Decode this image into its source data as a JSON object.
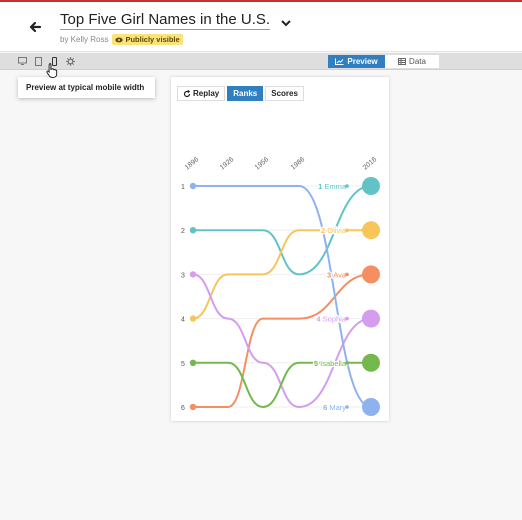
{
  "header": {
    "title": "Top Five Girl Names in the U.S.",
    "byline": "by Kelly Ross",
    "badge": "Publicly visible"
  },
  "toolbar": {
    "preview_label": "Preview",
    "data_label": "Data",
    "icons": [
      "desktop-icon",
      "tablet-icon",
      "mobile-icon",
      "settings-icon"
    ]
  },
  "tooltip": {
    "text": "Preview at typical mobile width"
  },
  "controls": {
    "replay": "Replay",
    "ranks": "Ranks",
    "scores": "Scores"
  },
  "chart_data": {
    "type": "line",
    "x": [
      "1896",
      "1926",
      "1956",
      "1986",
      "2016"
    ],
    "y_ticks": [
      "1",
      "2",
      "3",
      "4",
      "5",
      "6"
    ],
    "series": [
      {
        "name": "Emma",
        "rank_label": "1",
        "color": "#62c3c7",
        "values": [
          2,
          2,
          2,
          3,
          1
        ]
      },
      {
        "name": "Olivia",
        "rank_label": "2",
        "color": "#f7c55a",
        "values": [
          4,
          3,
          3,
          2,
          2
        ]
      },
      {
        "name": "Ava",
        "rank_label": "3",
        "color": "#f58e63",
        "values": [
          6,
          6,
          4,
          4,
          3
        ]
      },
      {
        "name": "Sophia",
        "rank_label": "4",
        "color": "#d59ded",
        "values": [
          3,
          4,
          5,
          6,
          4
        ]
      },
      {
        "name": "Isabella",
        "rank_label": "5",
        "color": "#74b84e",
        "values": [
          5,
          5,
          6,
          5,
          5
        ]
      },
      {
        "name": "Mary",
        "rank_label": "6",
        "color": "#8eb2ef",
        "values": [
          1,
          1,
          1,
          1,
          6
        ]
      }
    ],
    "ylim": [
      1,
      6
    ],
    "grid": true
  }
}
